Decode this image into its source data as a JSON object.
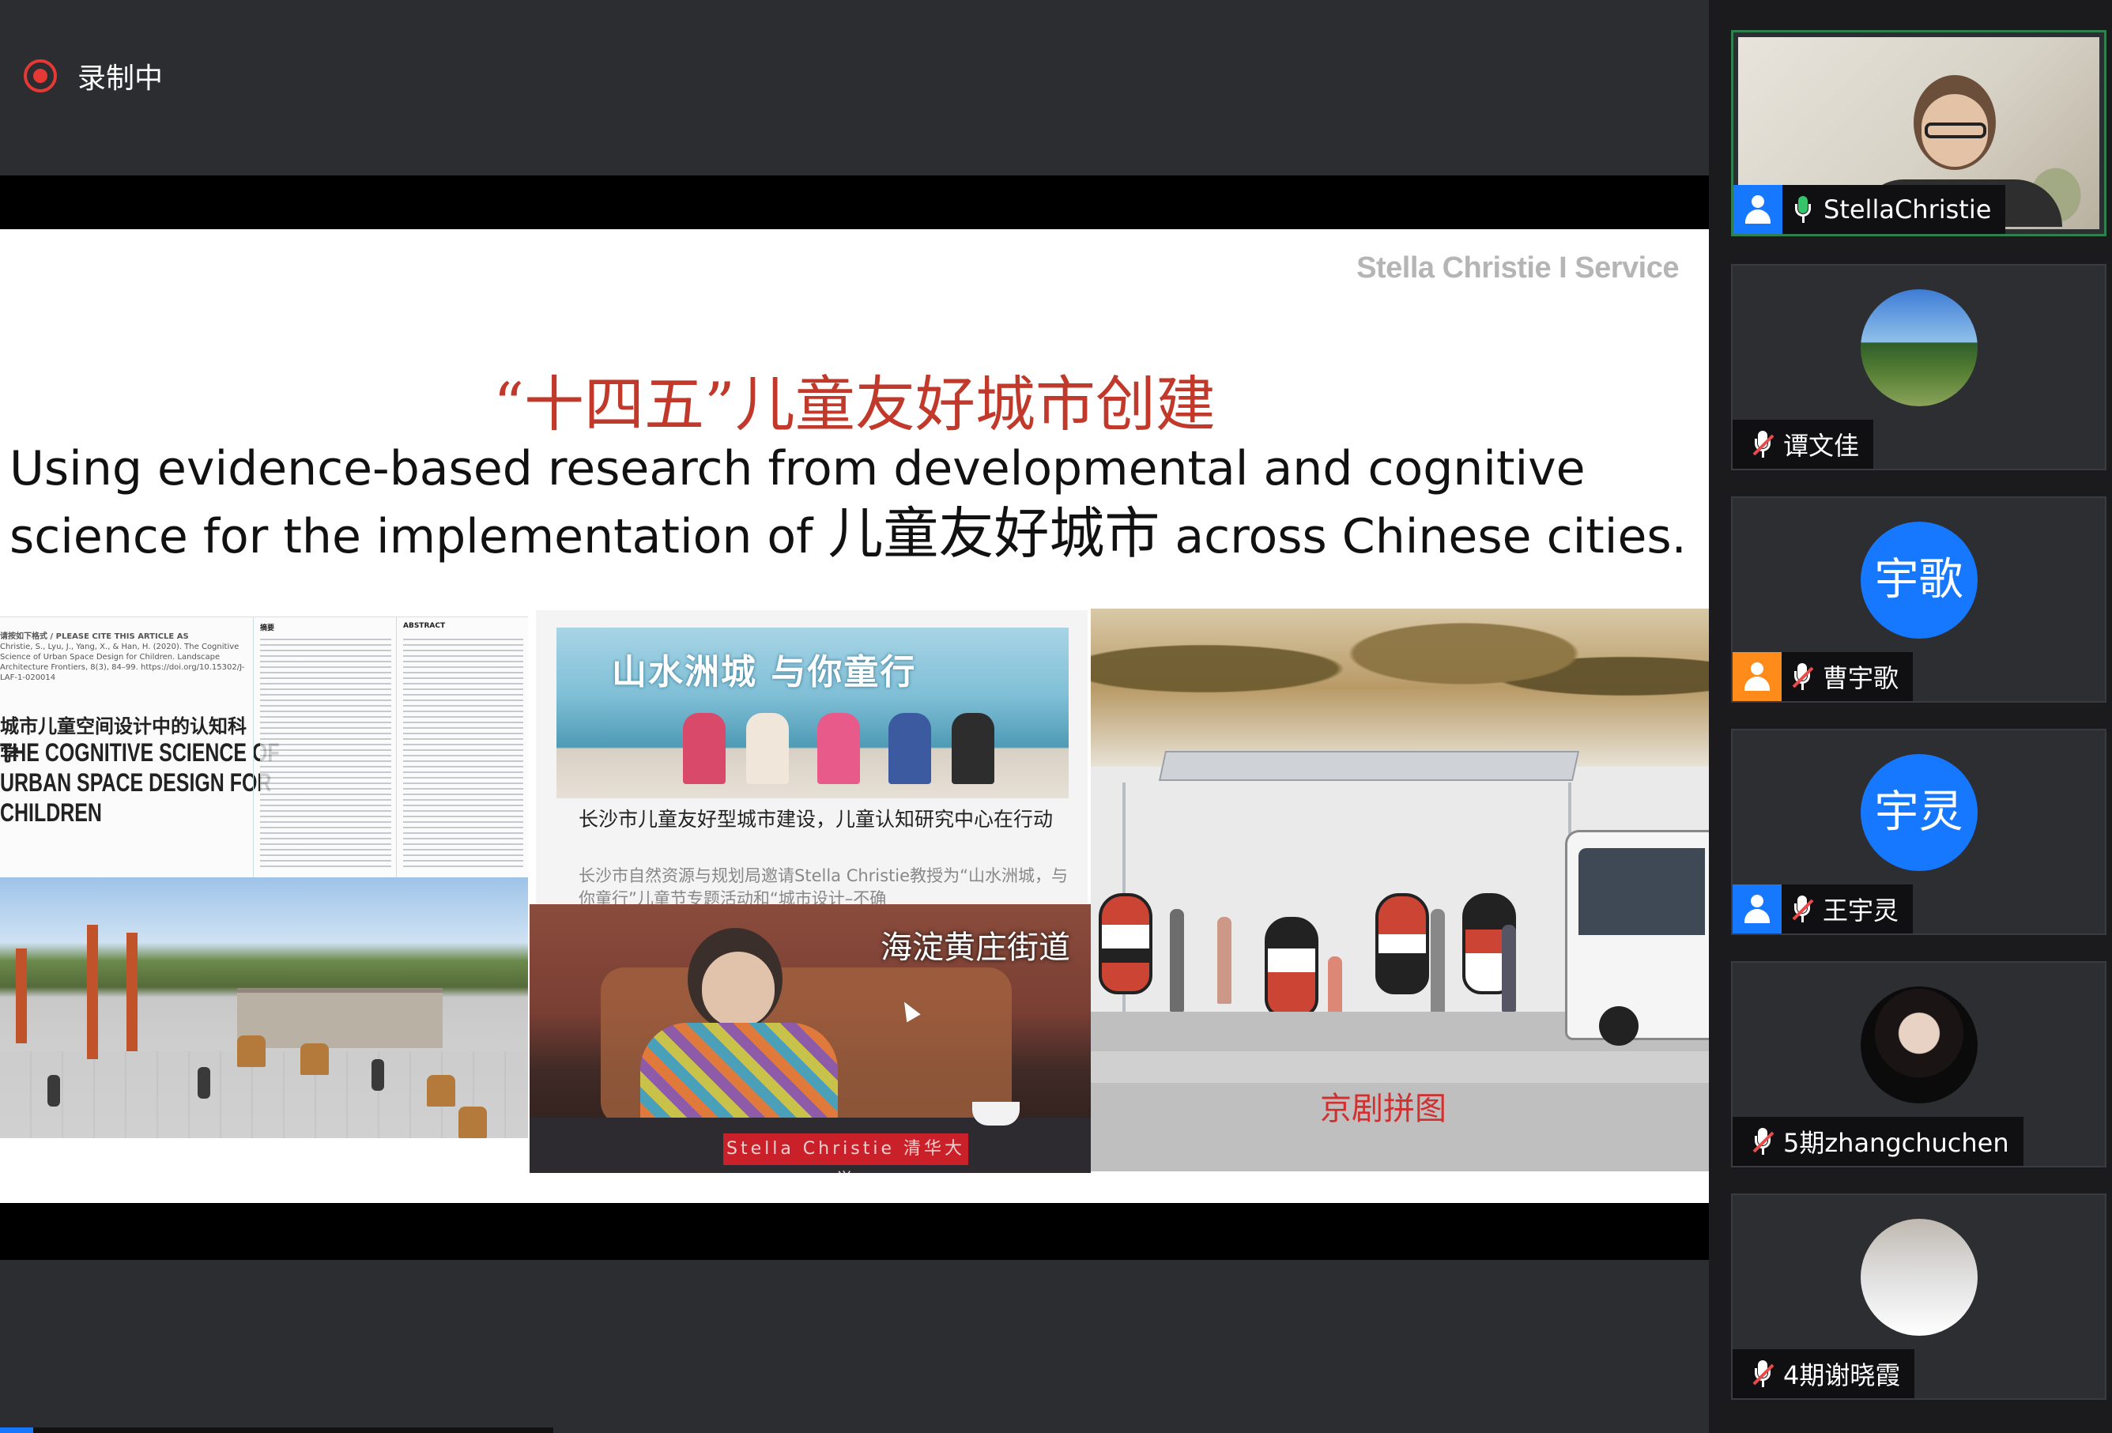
{
  "recording": {
    "label": "录制中",
    "status_color": "#e53935"
  },
  "slide": {
    "brand": "Stella Christie I Service",
    "title_cn": "“十四五”儿童友好城市创建",
    "subtitle_line1": "Using  evidence-based research from developmental and cognitive",
    "subtitle_line2_pre": "science for the implementation of ",
    "subtitle_line2_cn": "儿童友好城市",
    "subtitle_line2_post": " across Chinese cities.",
    "title_color": "#c0392b",
    "paper": {
      "cite_header": "请按如下格式 / PLEASE CITE THIS ARTICLE AS",
      "cite_text": "Christie, S., Lyu, J., Yang, X., & Han, H. (2020). The Cognitive Science of Urban Space Design for Children. Landscape Architecture Frontiers, 8(3), 84–99. https://doi.org/10.15302/J-LAF-1-020014",
      "title_cn": "城市儿童空间设计中的认知科学",
      "title_en_1": "THE COGNITIVE SCIENCE OF",
      "title_en_2": "URBAN SPACE DESIGN FOR",
      "title_en_3": "CHILDREN",
      "abstract_cn_label": "摘要",
      "abstract_en_label": "ABSTRACT"
    },
    "news": {
      "banner": "山水洲城 与你童行",
      "headline": "长沙市儿童友好型城市建设，儿童认知研究中心在行动",
      "body": "长沙市自然资源与规划局邀请Stella Christie教授为“山水洲城，与你童行”儿童节专题活动和“城市设计–不确"
    },
    "meeting": {
      "label": "海淀黄庄街道",
      "sign": "Stella Christie 清华大学"
    },
    "bus_stop": {
      "label": "京剧拼图"
    }
  },
  "participants": [
    {
      "name": "StellaChristie",
      "type": "video",
      "role_icon": "user-icon",
      "mic": "on",
      "active": true
    },
    {
      "name": "谭文佳",
      "type": "avatar-image",
      "avatar_style": "trees",
      "role_icon": "",
      "mic": "muted"
    },
    {
      "name": "曹宇歌",
      "type": "avatar-text",
      "avatar_text": "宇歌",
      "role_icon": "user-icon-orange",
      "mic": "muted"
    },
    {
      "name": "王宇灵",
      "type": "avatar-text",
      "avatar_text": "宇灵",
      "role_icon": "user-icon",
      "mic": "muted"
    },
    {
      "name": "5期zhangchuchen",
      "type": "avatar-image",
      "avatar_style": "woman",
      "role_icon": "",
      "mic": "muted"
    },
    {
      "name": "4期谢晓霞",
      "type": "avatar-image",
      "avatar_style": "kids",
      "role_icon": "",
      "mic": "muted"
    }
  ],
  "colors": {
    "accent_blue": "#1677ff",
    "host_orange": "#ff8c1a",
    "active_border": "#2f7f4f"
  },
  "progress": {
    "fraction": 0.06
  }
}
